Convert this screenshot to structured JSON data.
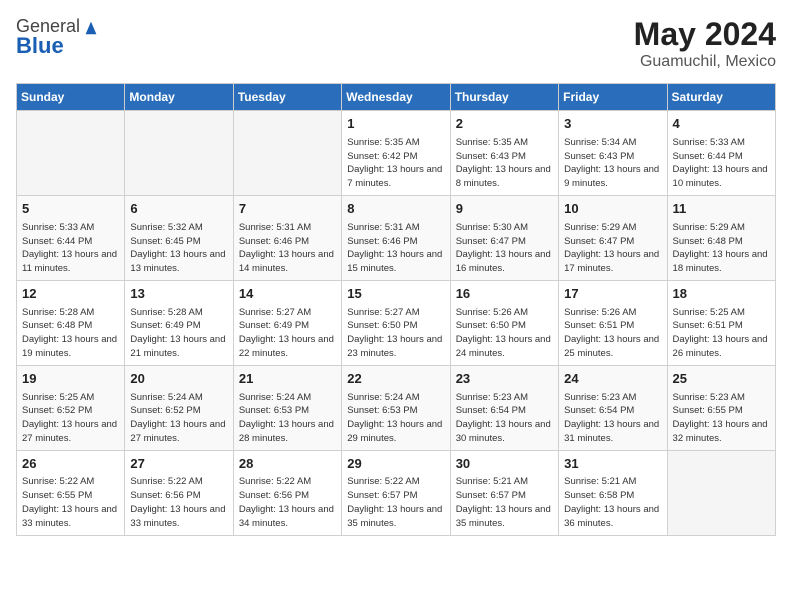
{
  "header": {
    "logo_general": "General",
    "logo_blue": "Blue",
    "month_year": "May 2024",
    "location": "Guamuchil, Mexico"
  },
  "days_of_week": [
    "Sunday",
    "Monday",
    "Tuesday",
    "Wednesday",
    "Thursday",
    "Friday",
    "Saturday"
  ],
  "weeks": [
    [
      {
        "day": "",
        "empty": true
      },
      {
        "day": "",
        "empty": true
      },
      {
        "day": "",
        "empty": true
      },
      {
        "day": "1",
        "sunrise": "Sunrise: 5:35 AM",
        "sunset": "Sunset: 6:42 PM",
        "daylight": "Daylight: 13 hours and 7 minutes."
      },
      {
        "day": "2",
        "sunrise": "Sunrise: 5:35 AM",
        "sunset": "Sunset: 6:43 PM",
        "daylight": "Daylight: 13 hours and 8 minutes."
      },
      {
        "day": "3",
        "sunrise": "Sunrise: 5:34 AM",
        "sunset": "Sunset: 6:43 PM",
        "daylight": "Daylight: 13 hours and 9 minutes."
      },
      {
        "day": "4",
        "sunrise": "Sunrise: 5:33 AM",
        "sunset": "Sunset: 6:44 PM",
        "daylight": "Daylight: 13 hours and 10 minutes."
      }
    ],
    [
      {
        "day": "5",
        "sunrise": "Sunrise: 5:33 AM",
        "sunset": "Sunset: 6:44 PM",
        "daylight": "Daylight: 13 hours and 11 minutes."
      },
      {
        "day": "6",
        "sunrise": "Sunrise: 5:32 AM",
        "sunset": "Sunset: 6:45 PM",
        "daylight": "Daylight: 13 hours and 13 minutes."
      },
      {
        "day": "7",
        "sunrise": "Sunrise: 5:31 AM",
        "sunset": "Sunset: 6:46 PM",
        "daylight": "Daylight: 13 hours and 14 minutes."
      },
      {
        "day": "8",
        "sunrise": "Sunrise: 5:31 AM",
        "sunset": "Sunset: 6:46 PM",
        "daylight": "Daylight: 13 hours and 15 minutes."
      },
      {
        "day": "9",
        "sunrise": "Sunrise: 5:30 AM",
        "sunset": "Sunset: 6:47 PM",
        "daylight": "Daylight: 13 hours and 16 minutes."
      },
      {
        "day": "10",
        "sunrise": "Sunrise: 5:29 AM",
        "sunset": "Sunset: 6:47 PM",
        "daylight": "Daylight: 13 hours and 17 minutes."
      },
      {
        "day": "11",
        "sunrise": "Sunrise: 5:29 AM",
        "sunset": "Sunset: 6:48 PM",
        "daylight": "Daylight: 13 hours and 18 minutes."
      }
    ],
    [
      {
        "day": "12",
        "sunrise": "Sunrise: 5:28 AM",
        "sunset": "Sunset: 6:48 PM",
        "daylight": "Daylight: 13 hours and 19 minutes."
      },
      {
        "day": "13",
        "sunrise": "Sunrise: 5:28 AM",
        "sunset": "Sunset: 6:49 PM",
        "daylight": "Daylight: 13 hours and 21 minutes."
      },
      {
        "day": "14",
        "sunrise": "Sunrise: 5:27 AM",
        "sunset": "Sunset: 6:49 PM",
        "daylight": "Daylight: 13 hours and 22 minutes."
      },
      {
        "day": "15",
        "sunrise": "Sunrise: 5:27 AM",
        "sunset": "Sunset: 6:50 PM",
        "daylight": "Daylight: 13 hours and 23 minutes."
      },
      {
        "day": "16",
        "sunrise": "Sunrise: 5:26 AM",
        "sunset": "Sunset: 6:50 PM",
        "daylight": "Daylight: 13 hours and 24 minutes."
      },
      {
        "day": "17",
        "sunrise": "Sunrise: 5:26 AM",
        "sunset": "Sunset: 6:51 PM",
        "daylight": "Daylight: 13 hours and 25 minutes."
      },
      {
        "day": "18",
        "sunrise": "Sunrise: 5:25 AM",
        "sunset": "Sunset: 6:51 PM",
        "daylight": "Daylight: 13 hours and 26 minutes."
      }
    ],
    [
      {
        "day": "19",
        "sunrise": "Sunrise: 5:25 AM",
        "sunset": "Sunset: 6:52 PM",
        "daylight": "Daylight: 13 hours and 27 minutes."
      },
      {
        "day": "20",
        "sunrise": "Sunrise: 5:24 AM",
        "sunset": "Sunset: 6:52 PM",
        "daylight": "Daylight: 13 hours and 27 minutes."
      },
      {
        "day": "21",
        "sunrise": "Sunrise: 5:24 AM",
        "sunset": "Sunset: 6:53 PM",
        "daylight": "Daylight: 13 hours and 28 minutes."
      },
      {
        "day": "22",
        "sunrise": "Sunrise: 5:24 AM",
        "sunset": "Sunset: 6:53 PM",
        "daylight": "Daylight: 13 hours and 29 minutes."
      },
      {
        "day": "23",
        "sunrise": "Sunrise: 5:23 AM",
        "sunset": "Sunset: 6:54 PM",
        "daylight": "Daylight: 13 hours and 30 minutes."
      },
      {
        "day": "24",
        "sunrise": "Sunrise: 5:23 AM",
        "sunset": "Sunset: 6:54 PM",
        "daylight": "Daylight: 13 hours and 31 minutes."
      },
      {
        "day": "25",
        "sunrise": "Sunrise: 5:23 AM",
        "sunset": "Sunset: 6:55 PM",
        "daylight": "Daylight: 13 hours and 32 minutes."
      }
    ],
    [
      {
        "day": "26",
        "sunrise": "Sunrise: 5:22 AM",
        "sunset": "Sunset: 6:55 PM",
        "daylight": "Daylight: 13 hours and 33 minutes."
      },
      {
        "day": "27",
        "sunrise": "Sunrise: 5:22 AM",
        "sunset": "Sunset: 6:56 PM",
        "daylight": "Daylight: 13 hours and 33 minutes."
      },
      {
        "day": "28",
        "sunrise": "Sunrise: 5:22 AM",
        "sunset": "Sunset: 6:56 PM",
        "daylight": "Daylight: 13 hours and 34 minutes."
      },
      {
        "day": "29",
        "sunrise": "Sunrise: 5:22 AM",
        "sunset": "Sunset: 6:57 PM",
        "daylight": "Daylight: 13 hours and 35 minutes."
      },
      {
        "day": "30",
        "sunrise": "Sunrise: 5:21 AM",
        "sunset": "Sunset: 6:57 PM",
        "daylight": "Daylight: 13 hours and 35 minutes."
      },
      {
        "day": "31",
        "sunrise": "Sunrise: 5:21 AM",
        "sunset": "Sunset: 6:58 PM",
        "daylight": "Daylight: 13 hours and 36 minutes."
      },
      {
        "day": "",
        "empty": true
      }
    ]
  ]
}
